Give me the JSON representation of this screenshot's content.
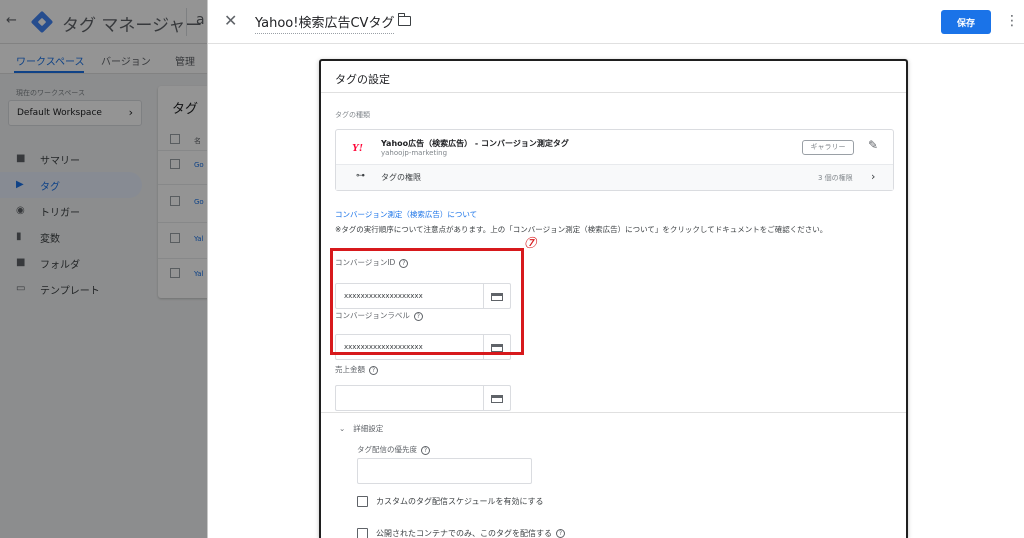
{
  "background_app": {
    "app_title": "タグ マネージャー",
    "title_extra": "a",
    "nav_tabs": [
      "ワークスペース",
      "バージョン",
      "管理"
    ],
    "workspace_label": "現在のワークスペース",
    "workspace_name": "Default Workspace",
    "sidebar": [
      "サマリー",
      "タグ",
      "トリガー",
      "変数",
      "フォルダ",
      "テンプレート"
    ],
    "card_title": "タグ",
    "card_header": "名",
    "rows": [
      "Go",
      "Go",
      "Yal",
      "Yal"
    ]
  },
  "editor": {
    "tag_name": "Yahoo!検索広告CVタグ",
    "save_label": "保存",
    "section_title": "タグの設定",
    "tag_type_label": "タグの種類",
    "type_logo": "Y!",
    "tag_type_name": "Yahoo広告（検索広告） - コンバージョン測定タグ",
    "tag_type_vendor": "yahoojp-marketing",
    "gallery_chip": "ギャラリー",
    "permissions_label": "タグの権限",
    "permissions_count": "3 個の権限",
    "doc_link": "コンバージョン測定（検索広告）について",
    "note": "※タグの実行順序について注意点があります。上の「コンバージョン測定（検索広告）について」をクリックしてドキュメントをご確認ください。",
    "fields": [
      {
        "label": "コンバージョンID",
        "value": "xxxxxxxxxxxxxxxxxxx"
      },
      {
        "label": "コンバージョンラベル",
        "value": "xxxxxxxxxxxxxxxxxxx"
      },
      {
        "label": "売上金額",
        "value": ""
      }
    ],
    "annotation_number": "⑦",
    "advanced_label": "詳細設定",
    "priority_label": "タグ配信の優先度",
    "custom_schedule_label": "カスタムのタグ配信スケジュールを有効にする",
    "publish_only_label": "公開されたコンテナでのみ、このタグを配信する"
  }
}
